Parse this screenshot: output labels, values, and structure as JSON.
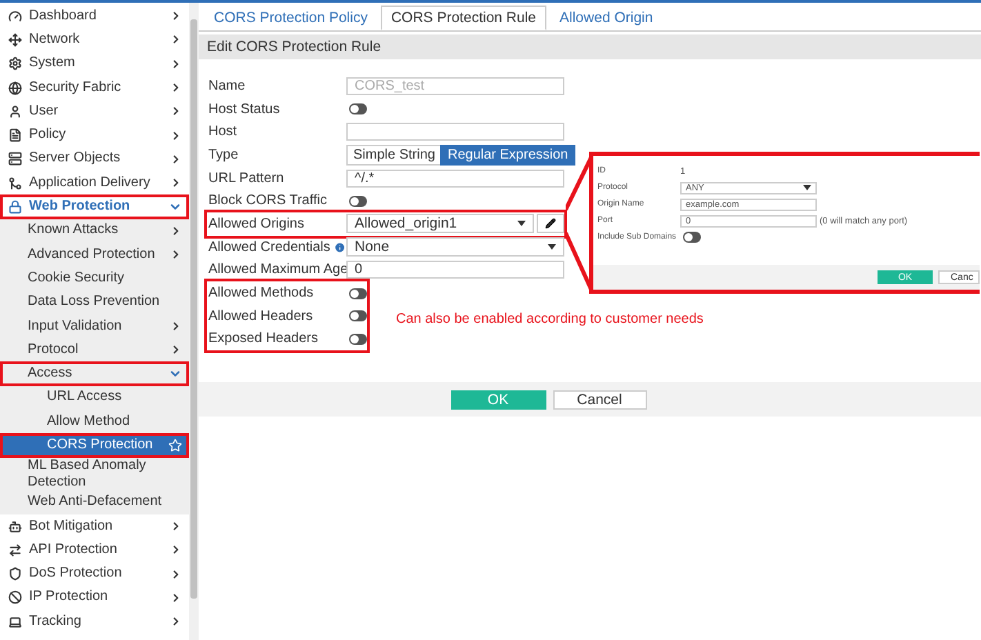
{
  "sidebar": {
    "items": [
      {
        "label": "Dashboard",
        "expanded": false,
        "selected": false,
        "annotated": false,
        "has_arrow": true
      },
      {
        "label": "Network",
        "expanded": false,
        "selected": false,
        "annotated": false,
        "has_arrow": true
      },
      {
        "label": "System",
        "expanded": false,
        "selected": false,
        "annotated": false,
        "has_arrow": true
      },
      {
        "label": "Security Fabric",
        "expanded": false,
        "selected": false,
        "annotated": false,
        "has_arrow": true
      },
      {
        "label": "User",
        "expanded": false,
        "selected": false,
        "annotated": false,
        "has_arrow": true
      },
      {
        "label": "Policy",
        "expanded": false,
        "selected": false,
        "annotated": false,
        "has_arrow": true
      },
      {
        "label": "Server Objects",
        "expanded": false,
        "selected": false,
        "annotated": false,
        "has_arrow": true
      },
      {
        "label": "Application Delivery",
        "expanded": false,
        "selected": false,
        "annotated": false,
        "has_arrow": true
      },
      {
        "label": "Web Protection",
        "expanded": true,
        "selected": false,
        "annotated": true,
        "has_arrow": true,
        "children": [
          {
            "label": "Known Attacks",
            "expanded": false,
            "selected": false,
            "annotated": false,
            "has_arrow": true
          },
          {
            "label": "Advanced Protection",
            "expanded": false,
            "selected": false,
            "annotated": false,
            "has_arrow": true
          },
          {
            "label": "Cookie Security",
            "expanded": false,
            "selected": false,
            "annotated": false,
            "has_arrow": false
          },
          {
            "label": "Data Loss Prevention",
            "expanded": false,
            "selected": false,
            "annotated": false,
            "has_arrow": false
          },
          {
            "label": "Input Validation",
            "expanded": false,
            "selected": false,
            "annotated": false,
            "has_arrow": true
          },
          {
            "label": "Protocol",
            "expanded": false,
            "selected": false,
            "annotated": false,
            "has_arrow": true
          },
          {
            "label": "Access",
            "expanded": true,
            "selected": false,
            "annotated": true,
            "has_arrow": true,
            "children": [
              {
                "label": "URL Access",
                "expanded": false,
                "selected": false,
                "annotated": false,
                "has_arrow": false
              },
              {
                "label": "Allow Method",
                "expanded": false,
                "selected": false,
                "annotated": false,
                "has_arrow": false
              },
              {
                "label": "CORS Protection",
                "expanded": false,
                "selected": true,
                "annotated": true,
                "has_arrow": false
              }
            ]
          },
          {
            "label": "ML Based Anomaly Detection",
            "expanded": false,
            "selected": false,
            "annotated": false,
            "has_arrow": false
          },
          {
            "label": "Web Anti-Defacement",
            "expanded": false,
            "selected": false,
            "annotated": false,
            "has_arrow": false
          }
        ]
      },
      {
        "label": "Bot Mitigation",
        "expanded": false,
        "selected": false,
        "annotated": false,
        "has_arrow": true
      },
      {
        "label": "API Protection",
        "expanded": false,
        "selected": false,
        "annotated": false,
        "has_arrow": true
      },
      {
        "label": "DoS Protection",
        "expanded": false,
        "selected": false,
        "annotated": false,
        "has_arrow": true
      },
      {
        "label": "IP Protection",
        "expanded": false,
        "selected": false,
        "annotated": false,
        "has_arrow": true
      },
      {
        "label": "Tracking",
        "expanded": false,
        "selected": false,
        "annotated": false,
        "has_arrow": true
      }
    ]
  },
  "tabs": [
    {
      "label": "CORS Protection Policy",
      "selected": false
    },
    {
      "label": "CORS Protection Rule",
      "selected": true
    },
    {
      "label": "Allowed Origin",
      "selected": false
    }
  ],
  "section_title": "Edit CORS Protection Rule",
  "form_groups": [
    {
      "annotated": false,
      "rows": [
        {
          "kind": "text",
          "label": "Name",
          "value": "CORS_test",
          "disabled": true
        },
        {
          "kind": "toggle",
          "label": "Host Status",
          "on": false
        },
        {
          "kind": "text",
          "label": "Host",
          "value": ""
        },
        {
          "kind": "segmented",
          "label": "Type",
          "options": [
            {
              "label": "Simple String",
              "selected": false
            },
            {
              "label": "Regular Expression",
              "selected": true
            }
          ]
        },
        {
          "kind": "text",
          "label": "URL Pattern",
          "value": "^/.*",
          "disabled": false
        },
        {
          "kind": "toggle",
          "label": "Block CORS Traffic",
          "on": false
        }
      ]
    },
    {
      "annotated": true,
      "rows": [
        {
          "kind": "select",
          "label": "Allowed Origins",
          "value": "Allowed_origin1",
          "editable": true
        }
      ]
    },
    {
      "annotated": false,
      "rows": [
        {
          "kind": "select",
          "label": "Allowed Credentials",
          "value": "None",
          "editable": false,
          "info": true
        },
        {
          "kind": "text",
          "label": "Allowed Maximum Age",
          "value": "0",
          "disabled": false
        }
      ]
    },
    {
      "annotated": true,
      "note": "Can also be enabled according to customer needs",
      "rows": [
        {
          "kind": "toggle",
          "label": "Allowed Methods",
          "on": false
        },
        {
          "kind": "toggle",
          "label": "Allowed Headers",
          "on": false
        },
        {
          "kind": "toggle",
          "label": "Exposed Headers",
          "on": false
        }
      ]
    }
  ],
  "buttons": [
    {
      "label": "OK",
      "kind": "primary"
    },
    {
      "label": "Cancel",
      "kind": "secondary"
    }
  ],
  "callout": {
    "rows": [
      {
        "kind": "static",
        "label": "ID",
        "value": "1"
      },
      {
        "kind": "select",
        "label": "Protocol",
        "value": "ANY"
      },
      {
        "kind": "text",
        "label": "Origin Name",
        "value": "example.com"
      },
      {
        "kind": "text",
        "label": "Port",
        "value": "0",
        "hint": "(0 will match any port)"
      },
      {
        "kind": "toggle",
        "label": "Include Sub Domains",
        "on": false
      }
    ],
    "buttons": [
      {
        "label": "OK",
        "kind": "primary"
      },
      {
        "label": "Canc",
        "kind": "secondary"
      }
    ]
  }
}
